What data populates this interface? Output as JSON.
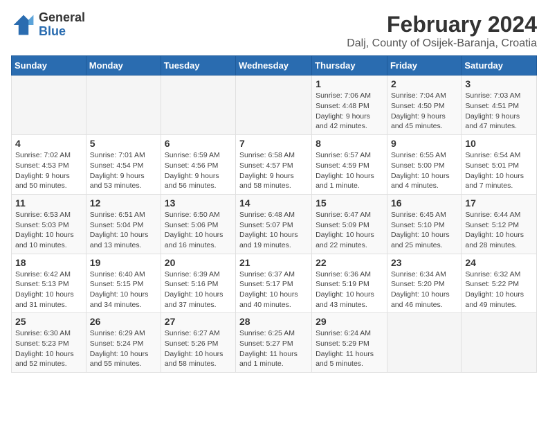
{
  "header": {
    "logo": {
      "general": "General",
      "blue": "Blue"
    },
    "title": "February 2024",
    "subtitle": "Dalj, County of Osijek-Baranja, Croatia"
  },
  "calendar": {
    "days_of_week": [
      "Sunday",
      "Monday",
      "Tuesday",
      "Wednesday",
      "Thursday",
      "Friday",
      "Saturday"
    ],
    "weeks": [
      [
        {
          "day": "",
          "info": ""
        },
        {
          "day": "",
          "info": ""
        },
        {
          "day": "",
          "info": ""
        },
        {
          "day": "",
          "info": ""
        },
        {
          "day": "1",
          "info": "Sunrise: 7:06 AM\nSunset: 4:48 PM\nDaylight: 9 hours\nand 42 minutes."
        },
        {
          "day": "2",
          "info": "Sunrise: 7:04 AM\nSunset: 4:50 PM\nDaylight: 9 hours\nand 45 minutes."
        },
        {
          "day": "3",
          "info": "Sunrise: 7:03 AM\nSunset: 4:51 PM\nDaylight: 9 hours\nand 47 minutes."
        }
      ],
      [
        {
          "day": "4",
          "info": "Sunrise: 7:02 AM\nSunset: 4:53 PM\nDaylight: 9 hours\nand 50 minutes."
        },
        {
          "day": "5",
          "info": "Sunrise: 7:01 AM\nSunset: 4:54 PM\nDaylight: 9 hours\nand 53 minutes."
        },
        {
          "day": "6",
          "info": "Sunrise: 6:59 AM\nSunset: 4:56 PM\nDaylight: 9 hours\nand 56 minutes."
        },
        {
          "day": "7",
          "info": "Sunrise: 6:58 AM\nSunset: 4:57 PM\nDaylight: 9 hours\nand 58 minutes."
        },
        {
          "day": "8",
          "info": "Sunrise: 6:57 AM\nSunset: 4:59 PM\nDaylight: 10 hours\nand 1 minute."
        },
        {
          "day": "9",
          "info": "Sunrise: 6:55 AM\nSunset: 5:00 PM\nDaylight: 10 hours\nand 4 minutes."
        },
        {
          "day": "10",
          "info": "Sunrise: 6:54 AM\nSunset: 5:01 PM\nDaylight: 10 hours\nand 7 minutes."
        }
      ],
      [
        {
          "day": "11",
          "info": "Sunrise: 6:53 AM\nSunset: 5:03 PM\nDaylight: 10 hours\nand 10 minutes."
        },
        {
          "day": "12",
          "info": "Sunrise: 6:51 AM\nSunset: 5:04 PM\nDaylight: 10 hours\nand 13 minutes."
        },
        {
          "day": "13",
          "info": "Sunrise: 6:50 AM\nSunset: 5:06 PM\nDaylight: 10 hours\nand 16 minutes."
        },
        {
          "day": "14",
          "info": "Sunrise: 6:48 AM\nSunset: 5:07 PM\nDaylight: 10 hours\nand 19 minutes."
        },
        {
          "day": "15",
          "info": "Sunrise: 6:47 AM\nSunset: 5:09 PM\nDaylight: 10 hours\nand 22 minutes."
        },
        {
          "day": "16",
          "info": "Sunrise: 6:45 AM\nSunset: 5:10 PM\nDaylight: 10 hours\nand 25 minutes."
        },
        {
          "day": "17",
          "info": "Sunrise: 6:44 AM\nSunset: 5:12 PM\nDaylight: 10 hours\nand 28 minutes."
        }
      ],
      [
        {
          "day": "18",
          "info": "Sunrise: 6:42 AM\nSunset: 5:13 PM\nDaylight: 10 hours\nand 31 minutes."
        },
        {
          "day": "19",
          "info": "Sunrise: 6:40 AM\nSunset: 5:15 PM\nDaylight: 10 hours\nand 34 minutes."
        },
        {
          "day": "20",
          "info": "Sunrise: 6:39 AM\nSunset: 5:16 PM\nDaylight: 10 hours\nand 37 minutes."
        },
        {
          "day": "21",
          "info": "Sunrise: 6:37 AM\nSunset: 5:17 PM\nDaylight: 10 hours\nand 40 minutes."
        },
        {
          "day": "22",
          "info": "Sunrise: 6:36 AM\nSunset: 5:19 PM\nDaylight: 10 hours\nand 43 minutes."
        },
        {
          "day": "23",
          "info": "Sunrise: 6:34 AM\nSunset: 5:20 PM\nDaylight: 10 hours\nand 46 minutes."
        },
        {
          "day": "24",
          "info": "Sunrise: 6:32 AM\nSunset: 5:22 PM\nDaylight: 10 hours\nand 49 minutes."
        }
      ],
      [
        {
          "day": "25",
          "info": "Sunrise: 6:30 AM\nSunset: 5:23 PM\nDaylight: 10 hours\nand 52 minutes."
        },
        {
          "day": "26",
          "info": "Sunrise: 6:29 AM\nSunset: 5:24 PM\nDaylight: 10 hours\nand 55 minutes."
        },
        {
          "day": "27",
          "info": "Sunrise: 6:27 AM\nSunset: 5:26 PM\nDaylight: 10 hours\nand 58 minutes."
        },
        {
          "day": "28",
          "info": "Sunrise: 6:25 AM\nSunset: 5:27 PM\nDaylight: 11 hours\nand 1 minute."
        },
        {
          "day": "29",
          "info": "Sunrise: 6:24 AM\nSunset: 5:29 PM\nDaylight: 11 hours\nand 5 minutes."
        },
        {
          "day": "",
          "info": ""
        },
        {
          "day": "",
          "info": ""
        }
      ]
    ]
  }
}
